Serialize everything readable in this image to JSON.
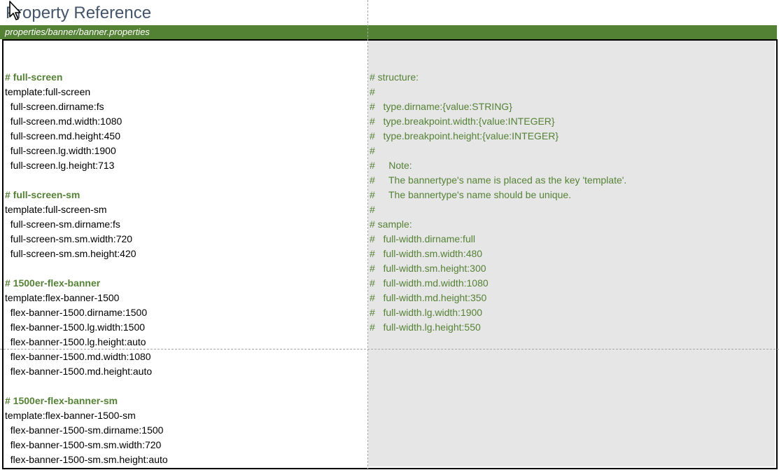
{
  "page_title": "Property Reference",
  "file_path": "properties/banner/banner.properties",
  "left_lines": [
    {
      "text": ""
    },
    {
      "text": "# full-screen",
      "heading": true
    },
    {
      "text": "template:full-screen"
    },
    {
      "text": "  full-screen.dirname:fs"
    },
    {
      "text": "  full-screen.md.width:1080"
    },
    {
      "text": "  full-screen.md.height:450"
    },
    {
      "text": "  full-screen.lg.width:1900"
    },
    {
      "text": "  full-screen.lg.height:713"
    },
    {
      "text": ""
    },
    {
      "text": "# full-screen-sm",
      "heading": true
    },
    {
      "text": "template:full-screen-sm"
    },
    {
      "text": "  full-screen-sm.dirname:fs"
    },
    {
      "text": "  full-screen-sm.sm.width:720"
    },
    {
      "text": "  full-screen-sm.sm.height:420"
    },
    {
      "text": ""
    },
    {
      "text": "# 1500er-flex-banner",
      "heading": true
    },
    {
      "text": "template:flex-banner-1500"
    },
    {
      "text": "  flex-banner-1500.dirname:1500"
    },
    {
      "text": "  flex-banner-1500.lg.width:1500"
    },
    {
      "text": "  flex-banner-1500.lg.height:auto"
    },
    {
      "text": "  flex-banner-1500.md.width:1080"
    },
    {
      "text": "  flex-banner-1500.md.height:auto"
    },
    {
      "text": ""
    },
    {
      "text": "# 1500er-flex-banner-sm",
      "heading": true
    },
    {
      "text": "template:flex-banner-1500-sm"
    },
    {
      "text": "  flex-banner-1500-sm.dirname:1500"
    },
    {
      "text": "  flex-banner-1500-sm.sm.width:720"
    },
    {
      "text": "  flex-banner-1500-sm.sm.height:auto"
    }
  ],
  "right_lines": [
    "",
    "# structure:",
    "#",
    "#   type.dirname:{value:STRING}",
    "#   type.breakpoint.width:{value:INTEGER}",
    "#   type.breakpoint.height:{value:INTEGER}",
    "#",
    "#     Note:",
    "#     The bannertype's name is placed as the key 'template'.",
    "#     The bannertype's name should be unique.",
    "#",
    "# sample:",
    "#   full-width.dirname:full",
    "#   full-width.sm.width:480",
    "#   full-width.sm.height:300",
    "#   full-width.md.width:1080",
    "#   full-width.md.height:350",
    "#   full-width.lg.width:1900",
    "#   full-width.lg.height:550"
  ],
  "colors": {
    "header_bar": "#548235",
    "comment_text": "#548235",
    "title_text": "#44546a",
    "right_pane_bg": "#e7e6e6"
  },
  "icons": {
    "cursor": "mouse-pointer-icon"
  }
}
